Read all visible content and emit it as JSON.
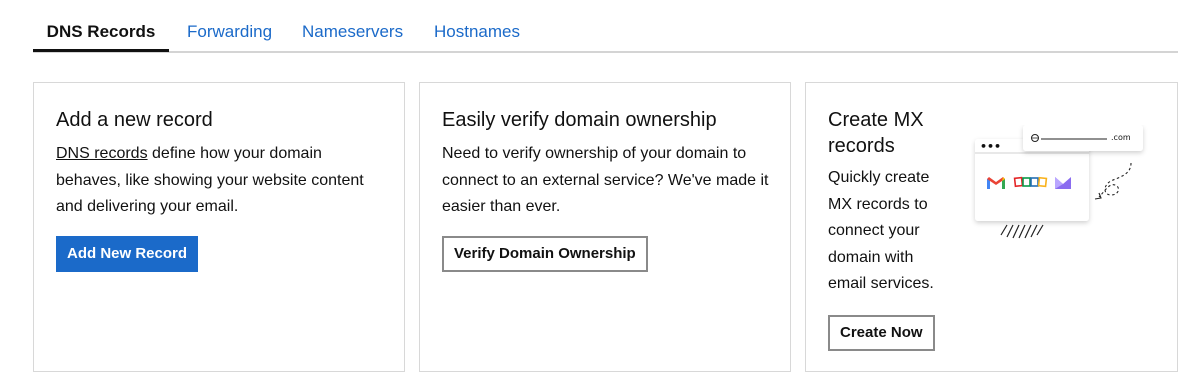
{
  "tabs": [
    {
      "label": "DNS Records",
      "active": true
    },
    {
      "label": "Forwarding",
      "active": false
    },
    {
      "label": "Nameservers",
      "active": false
    },
    {
      "label": "Hostnames",
      "active": false
    }
  ],
  "cards": {
    "add_record": {
      "title": "Add a new record",
      "link_text": "DNS records",
      "body_rest": " define how your domain behaves, like showing your website content and delivering your email.",
      "button_label": "Add New Record"
    },
    "verify": {
      "title": "Easily verify domain ownership",
      "body": "Need to verify ownership of your domain to connect to an external service? We've made it easier than ever.",
      "button_label": "Verify Domain Ownership"
    },
    "mx": {
      "title": "Create MX records",
      "body": "Quickly create MX records to connect your domain with email services.",
      "button_label": "Create Now",
      "illustration": {
        "url_suffix": ".com",
        "menu_dots": "•••",
        "icons": [
          "gmail-icon",
          "zoho-icon",
          "proton-icon"
        ]
      }
    }
  },
  "colors": {
    "accent": "#1b6ac9",
    "text": "#111111",
    "border": "#d8d8d8"
  }
}
